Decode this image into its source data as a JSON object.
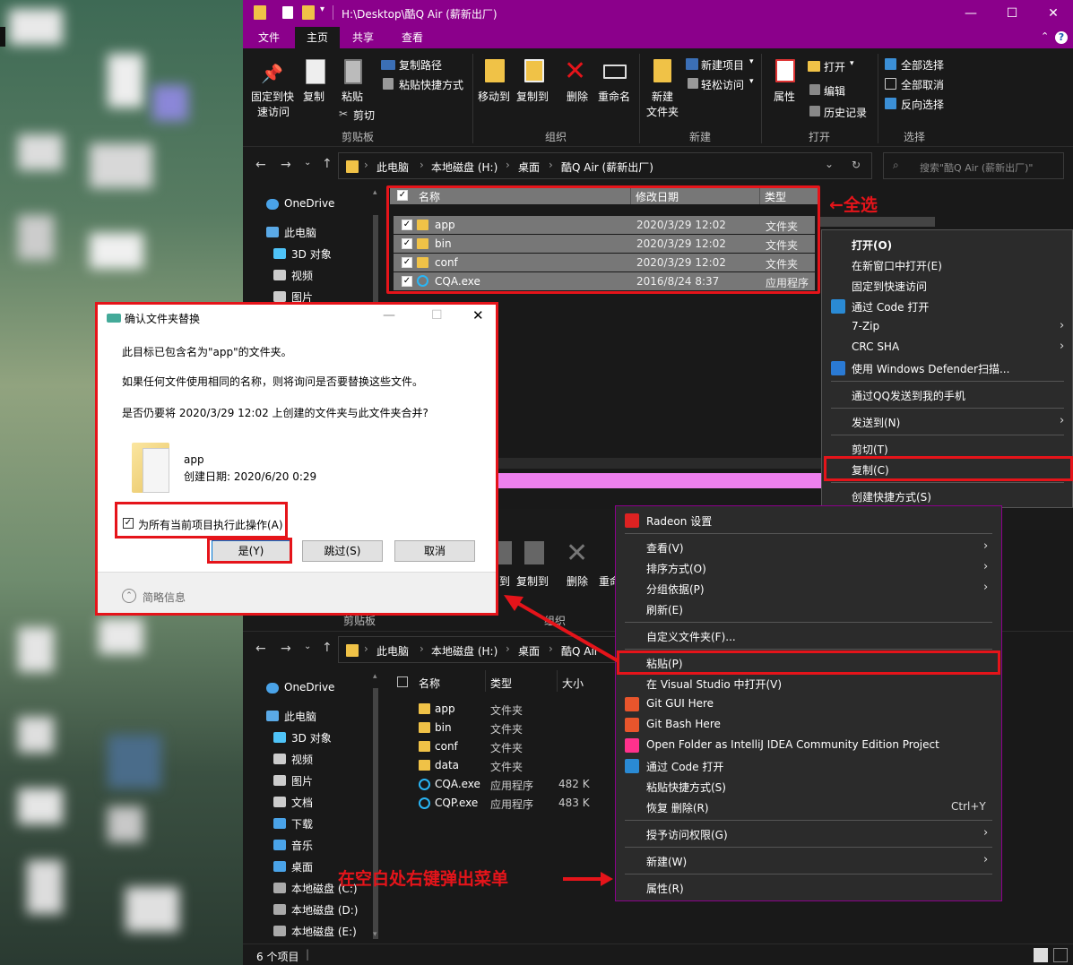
{
  "window_top": {
    "title": "H:\\Desktop\\酷Q Air (薪新出厂)",
    "tabs": [
      "文件",
      "主页",
      "共享",
      "查看"
    ],
    "ribbon": {
      "pin_label_1": "固定到快",
      "pin_label_2": "速访问",
      "copy_label": "复制",
      "paste_label": "粘贴",
      "copy_path": "复制路径",
      "paste_shortcut": "粘贴快捷方式",
      "cut": "剪切",
      "move_to": "移动到",
      "copy_to": "复制到",
      "delete": "删除",
      "rename": "重命名",
      "new_folder_1": "新建",
      "new_folder_2": "文件夹",
      "new_item": "新建项目",
      "easy_access": "轻松访问",
      "properties": "属性",
      "open": "打开",
      "edit": "编辑",
      "history": "历史记录",
      "select_all": "全部选择",
      "select_none": "全部取消",
      "invert_selection": "反向选择",
      "groups": [
        "剪贴板",
        "组织",
        "新建",
        "打开",
        "选择"
      ]
    },
    "breadcrumbs": [
      "此电脑",
      "本地磁盘 (H:)",
      "桌面",
      "酷Q Air (薪新出厂)"
    ],
    "search_placeholder": "搜索\"酷Q Air (薪新出厂)\"",
    "nav": [
      "OneDrive",
      "此电脑",
      "3D 对象",
      "视频",
      "图片"
    ],
    "columns": [
      "名称",
      "修改日期",
      "类型"
    ],
    "files": [
      {
        "name": "app",
        "date": "2020/3/29 12:02",
        "type": "文件夹"
      },
      {
        "name": "bin",
        "date": "2020/3/29 12:02",
        "type": "文件夹"
      },
      {
        "name": "conf",
        "date": "2020/3/29 12:02",
        "type": "文件夹"
      },
      {
        "name": "CQA.exe",
        "date": "2016/8/24 8:37",
        "type": "应用程序"
      }
    ]
  },
  "context_menu_top": {
    "items": [
      "打开(O)",
      "在新窗口中打开(E)",
      "固定到快速访问",
      "通过 Code 打开",
      "7-Zip",
      "CRC SHA",
      "使用 Windows Defender扫描...",
      "通过QQ发送到我的手机",
      "发送到(N)",
      "剪切(T)",
      "复制(C)",
      "创建快捷方式(S)"
    ]
  },
  "window_bottom": {
    "ribbon": {
      "copy_to": "复制到",
      "delete": "删除",
      "rename_partial": "重命",
      "move_partial": "到",
      "groups": [
        "剪贴板",
        "组织"
      ]
    },
    "breadcrumbs": [
      "此电脑",
      "本地磁盘 (H:)",
      "桌面",
      "酷Q Air"
    ],
    "nav": [
      "OneDrive",
      "此电脑",
      "3D 对象",
      "视频",
      "图片",
      "文档",
      "下载",
      "音乐",
      "桌面",
      "本地磁盘 (C:)",
      "本地磁盘 (D:)",
      "本地磁盘 (E:)"
    ],
    "columns": [
      "名称",
      "类型",
      "大小"
    ],
    "files": [
      {
        "name": "app",
        "type": "文件夹",
        "size": ""
      },
      {
        "name": "bin",
        "type": "文件夹",
        "size": ""
      },
      {
        "name": "conf",
        "type": "文件夹",
        "size": ""
      },
      {
        "name": "data",
        "type": "文件夹",
        "size": ""
      },
      {
        "name": "CQA.exe",
        "type": "应用程序",
        "size": "482 K"
      },
      {
        "name": "CQP.exe",
        "type": "应用程序",
        "size": "483 K"
      }
    ],
    "status": "6 个项目"
  },
  "context_menu_bottom": {
    "items": [
      "Radeon 设置",
      "查看(V)",
      "排序方式(O)",
      "分组依据(P)",
      "刷新(E)",
      "自定义文件夹(F)...",
      "粘贴(P)",
      "在 Visual Studio 中打开(V)",
      "Git GUI Here",
      "Git Bash Here",
      "Open Folder as IntelliJ IDEA Community Edition Project",
      "通过 Code 打开",
      "粘贴快捷方式(S)",
      "恢复 删除(R)",
      "授予访问权限(G)",
      "新建(W)",
      "属性(R)"
    ],
    "undo_shortcut": "Ctrl+Y"
  },
  "dialog": {
    "title": "确认文件夹替换",
    "line1": "此目标已包含名为\"app\"的文件夹。",
    "line2": "如果任何文件使用相同的名称，则将询问是否要替换这些文件。",
    "line3": "是否仍要将 2020/3/29 12:02 上创建的文件夹与此文件夹合并?",
    "folder_name": "app",
    "folder_created": "创建日期: 2020/6/20 0:29",
    "apply_all": "为所有当前项目执行此操作(A)",
    "yes": "是(Y)",
    "skip": "跳过(S)",
    "cancel": "取消",
    "brief": "简略信息"
  },
  "annotations": {
    "select_all": "←全选",
    "right_click": "在空白处右键弹出菜单"
  },
  "colors": {
    "accent": "#8b008b",
    "annotation": "#e5141a",
    "folder": "#f0c247"
  }
}
